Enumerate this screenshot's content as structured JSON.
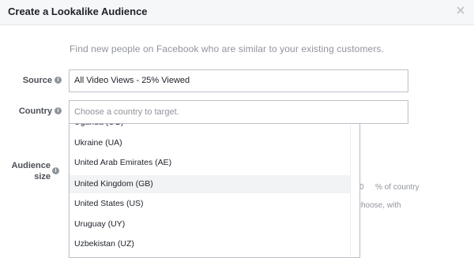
{
  "dialog": {
    "title": "Create a Lookalike Audience",
    "close_glyph": "×",
    "intro": "Find new people on Facebook who are similar to your existing customers."
  },
  "source": {
    "label": "Source",
    "value": "All Video Views - 25% Viewed"
  },
  "country": {
    "label": "Country",
    "placeholder": "Choose a country to target."
  },
  "audience_size": {
    "label_line1": "Audience",
    "label_line2": "size",
    "partial_value": "0",
    "unit": "% of country",
    "partial_hint": "choose, with"
  },
  "help_glyph": "i",
  "dropdown": {
    "partial_top": "Uganda (UG)",
    "options": [
      "Ukraine (UA)",
      "United Arab Emirates (AE)",
      "United Kingdom (GB)",
      "United States (US)",
      "Uruguay (UY)",
      "Uzbekistan (UZ)"
    ],
    "highlighted_index": 2
  }
}
